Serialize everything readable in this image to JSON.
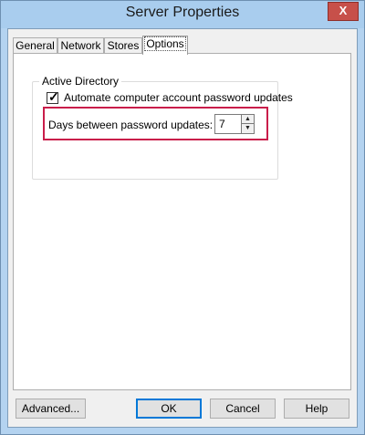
{
  "window": {
    "title": "Server Properties",
    "close_label": "X"
  },
  "tabs": [
    "General",
    "Network",
    "Stores",
    "Options"
  ],
  "active_tab": "Options",
  "active_directory": {
    "group_label": "Active Directory",
    "automate_label": "Automate computer account password updates",
    "automate_checked": true,
    "days_label": "Days between password updates:",
    "days_value": "7"
  },
  "buttons": {
    "advanced": "Advanced...",
    "ok": "OK",
    "cancel": "Cancel",
    "help": "Help"
  },
  "colors": {
    "highlight": "#c91d4a",
    "titlebar": "#a9cdee",
    "close": "#c7504a"
  }
}
